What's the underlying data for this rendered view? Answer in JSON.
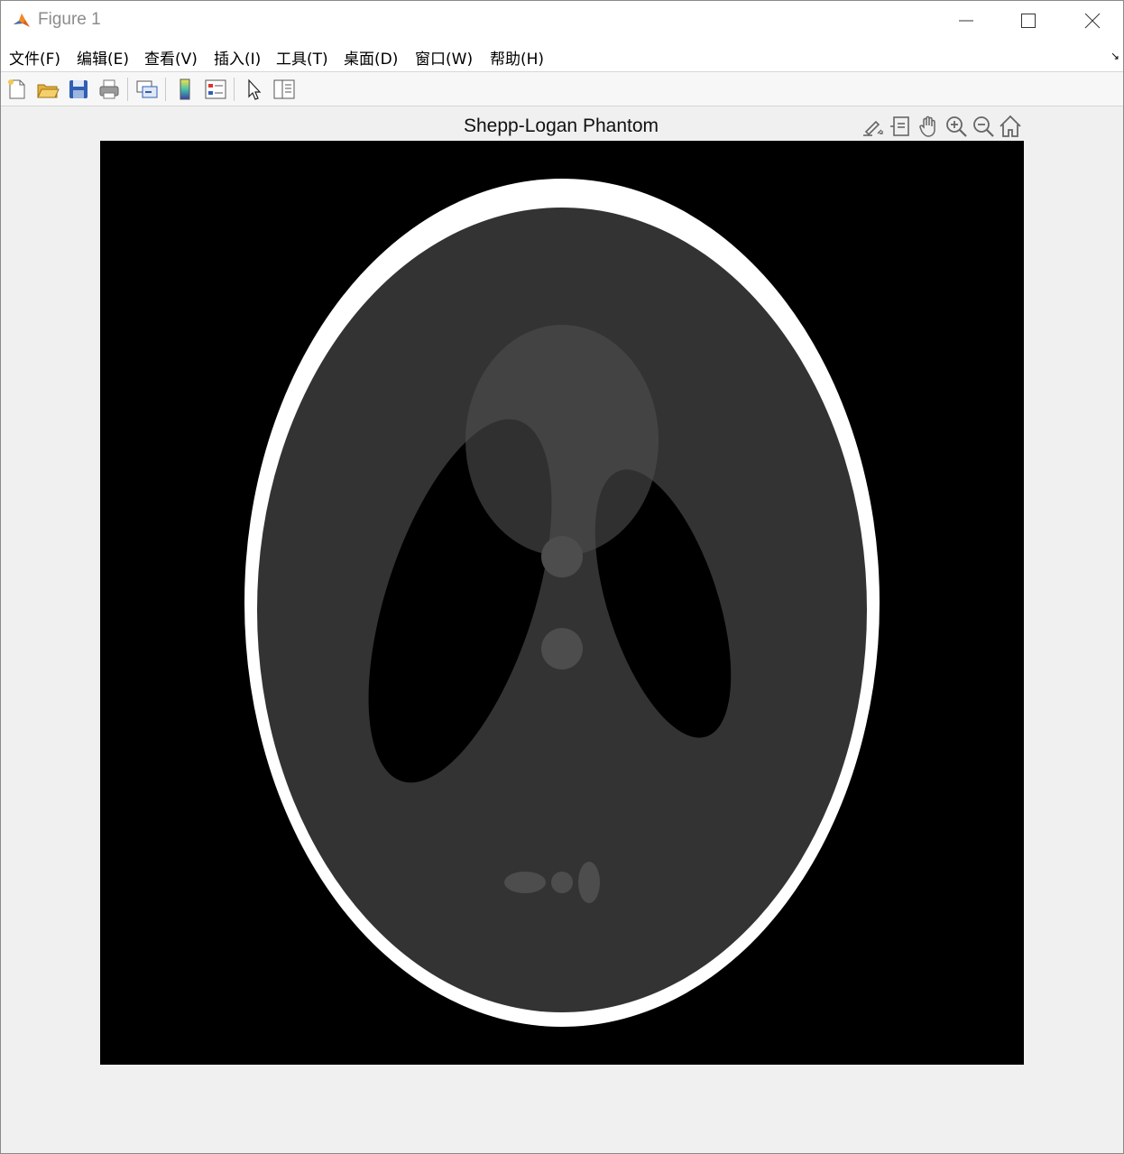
{
  "window": {
    "title": "Figure 1",
    "controls": [
      "minimize-icon",
      "maximize-icon",
      "close-icon"
    ]
  },
  "menubar": {
    "items": [
      {
        "label": "文件(F)"
      },
      {
        "label": "编辑(E)"
      },
      {
        "label": "查看(V)"
      },
      {
        "label": "插入(I)"
      },
      {
        "label": "工具(T)"
      },
      {
        "label": "桌面(D)"
      },
      {
        "label": "窗口(W)"
      },
      {
        "label": "帮助(H)"
      }
    ]
  },
  "toolbar": {
    "buttons": [
      "new-figure-icon",
      "open-file-icon",
      "save-icon",
      "print-icon",
      "link-plot-icon",
      "colorbar-icon",
      "legend-icon",
      "edit-plot-pointer-icon",
      "property-inspector-icon"
    ]
  },
  "axes": {
    "title": "Shepp-Logan Phantom",
    "toolbar": [
      "brush-icon",
      "data-tips-icon",
      "pan-icon",
      "zoom-in-icon",
      "zoom-out-icon",
      "restore-view-icon"
    ]
  },
  "image": {
    "name": "Shepp-Logan phantom",
    "colors": {
      "background": "#000000",
      "outer": "#ffffff",
      "brain": "#333333",
      "ventricle": "#000000",
      "light": "#4d4d4d"
    }
  }
}
